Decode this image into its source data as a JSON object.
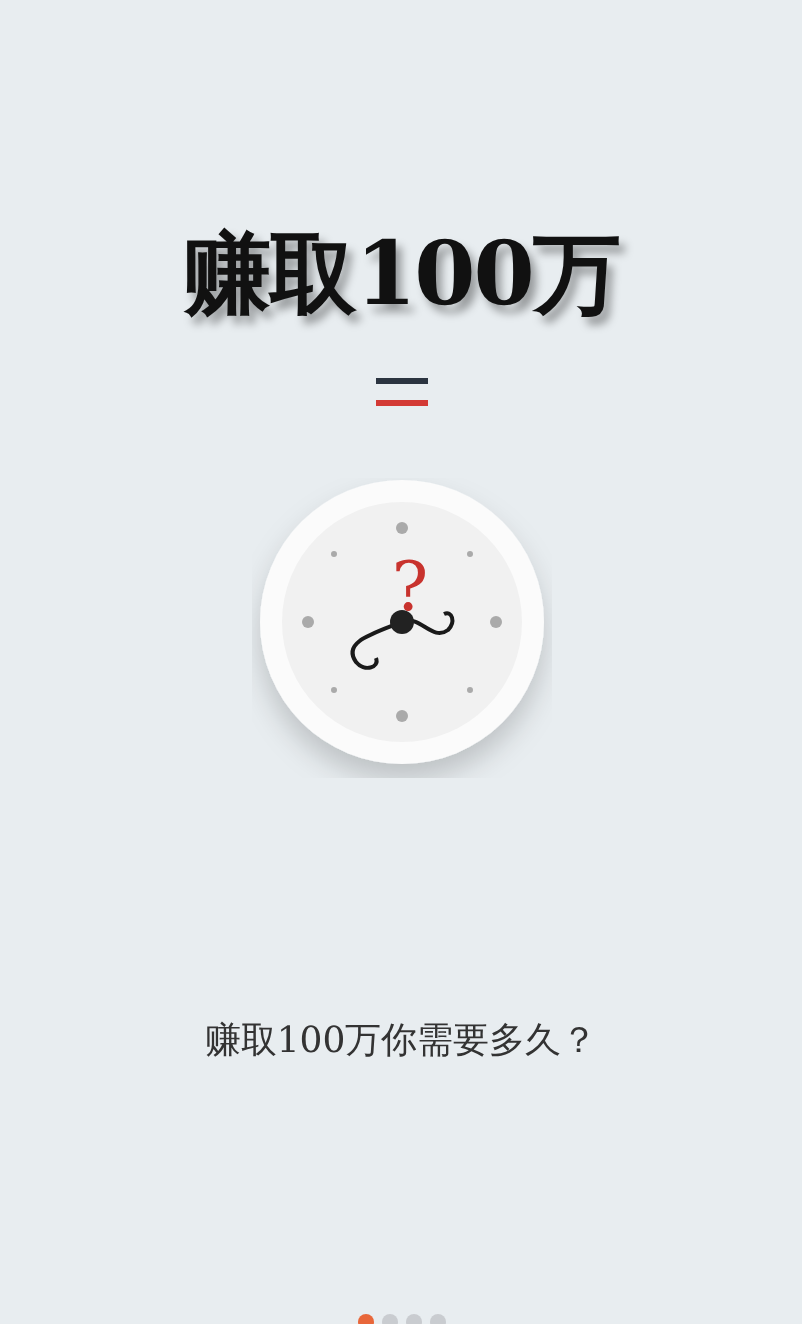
{
  "title": "赚取100万",
  "clock": {
    "mark": "?"
  },
  "question": "赚取100万你需要多久？",
  "pages": [
    {
      "selected": true
    },
    {
      "selected": false
    },
    {
      "selected": false
    },
    {
      "selected": false
    }
  ]
}
